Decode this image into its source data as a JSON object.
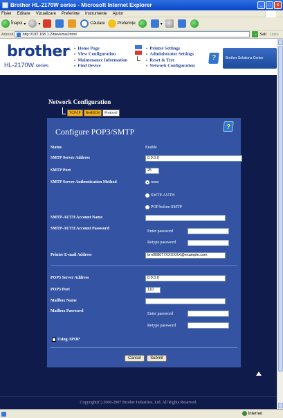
{
  "window": {
    "title": "Brother HL-2170W series - Microsoft Internet Explorer"
  },
  "menu": [
    "Fișier",
    "Editare",
    "Vizualizare",
    "Preferințe",
    "Instrumente",
    "Ajutor"
  ],
  "toolbar": {
    "back_label": "Înapoi",
    "search_label": "Căutare",
    "favorites_label": "Preferințe"
  },
  "address": {
    "label": "Adresă",
    "url": "http://192.168.1.2/bio/email.html",
    "go_label": "Salt",
    "links_label": "Links"
  },
  "brand": {
    "logo": "brother",
    "model": "HL-2170W",
    "series": "series",
    "solutions_label": "Brother Solutions Center"
  },
  "nav": {
    "left": [
      "Home Page",
      "View Configuration",
      "Maintenance Information",
      "Find Device"
    ],
    "right": [
      "Printer Settings",
      "Administrator Settings",
      "Reset & Test",
      "Network Configuration"
    ]
  },
  "section": {
    "title": "Network Configuration",
    "tabs": [
      "TCP/IP",
      "NetBIOS",
      "Protocol"
    ],
    "active_tab": "TCP/IP"
  },
  "panel": {
    "title": "Configure POP3/SMTP",
    "help_glyph": "?"
  },
  "form": {
    "status_label": "Status",
    "status_value": "Enable",
    "smtp_server_label": "SMTP Server Address",
    "smtp_server_value": "0.0.0.0",
    "smtp_port_label": "SMTP Port",
    "smtp_port_value": "25",
    "auth_method_label": "SMTP Server Authentication Method",
    "auth_options": [
      "none",
      "SMTP-AUTH",
      "POP before SMTP"
    ],
    "auth_selected": "none",
    "auth_account_name_label": "SMTP-AUTH Account Name",
    "auth_account_name_value": "",
    "auth_account_password_label": "SMTP-AUTH Account Password",
    "enter_password_label": "Enter password",
    "retype_password_label": "Retype password",
    "printer_email_label": "Printer E-mail Address",
    "printer_email_value": "brn008077XXXXXX@example.com",
    "pop3_server_label": "POP3 Server Address",
    "pop3_server_value": "0.0.0.0",
    "pop3_port_label": "POP3 Port",
    "pop3_port_value": "110",
    "mailbox_name_label": "Mailbox Name",
    "mailbox_name_value": "",
    "mailbox_password_label": "Mailbox Password",
    "apop_label": "Using APOP",
    "cancel_label": "Cancel",
    "submit_label": "Submit"
  },
  "footer": {
    "copyright": "Copyright(C) 2000-2007 Brother Industries, Ltd. All Rights Reserved."
  },
  "statusbar": {
    "zone": "Internet"
  }
}
